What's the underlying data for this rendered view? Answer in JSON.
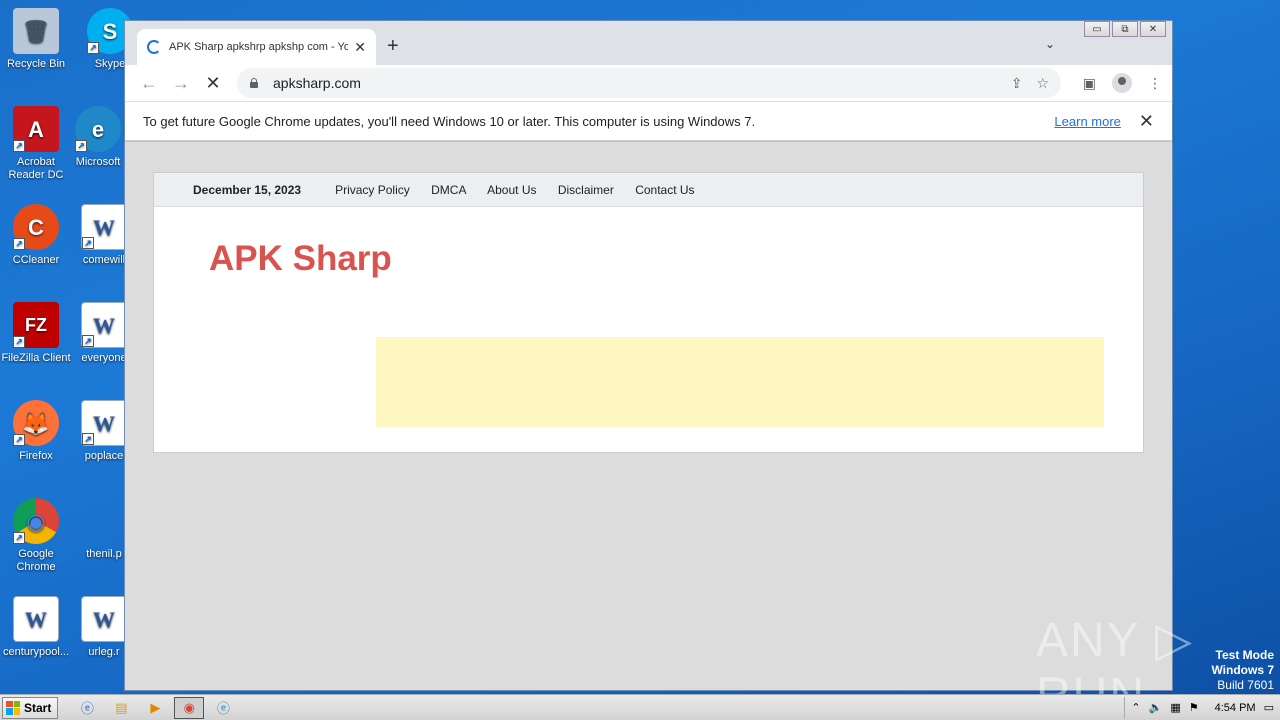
{
  "desktop": {
    "icons": [
      {
        "label": "Recycle Bin",
        "glyph": "🗑"
      },
      {
        "label": "Skype",
        "glyph": "S"
      },
      {
        "label": "Acrobat Reader DC",
        "glyph": "A"
      },
      {
        "label": "Microsoft",
        "glyph": "e"
      },
      {
        "label": "CCleaner",
        "glyph": "C"
      },
      {
        "label": "comewill",
        "glyph": "W"
      },
      {
        "label": "FileZilla Client",
        "glyph": "FZ"
      },
      {
        "label": "everyone",
        "glyph": "W"
      },
      {
        "label": "Firefox",
        "glyph": "🦊"
      },
      {
        "label": "poplace",
        "glyph": "W"
      },
      {
        "label": "Google Chrome",
        "glyph": "◉"
      },
      {
        "label": "thenil.p",
        "glyph": ""
      },
      {
        "label": "centurypool...",
        "glyph": "W"
      },
      {
        "label": "urleg.r",
        "glyph": "W"
      }
    ]
  },
  "browser": {
    "tab": {
      "title": "APK Sharp apkshrp apkshp com - Yo",
      "close": "✕"
    },
    "new_tab": "+",
    "tab_list": "⌄",
    "window_controls": {
      "minimize": "▭",
      "restore": "⧉",
      "close": "✕"
    },
    "nav": {
      "back": "←",
      "forward": "→",
      "stop": "✕"
    },
    "url": "apksharp.com",
    "infobar": {
      "message": "To get future Google Chrome updates, you'll need Windows 10 or later. This computer is using Windows 7.",
      "link": "Learn more",
      "close": "✕"
    }
  },
  "site": {
    "date": "December 15, 2023",
    "nav": [
      "Privacy Policy",
      "DMCA",
      "About Us",
      "Disclaimer",
      "Contact Us"
    ],
    "logo": "APK Sharp"
  },
  "watermark": {
    "text": "ANY ▷ RUN"
  },
  "testmode": {
    "line1": "Test Mode",
    "line2": "Windows 7",
    "line3": "Build 7601"
  },
  "taskbar": {
    "start": "Start",
    "clock": "4:54 PM"
  }
}
